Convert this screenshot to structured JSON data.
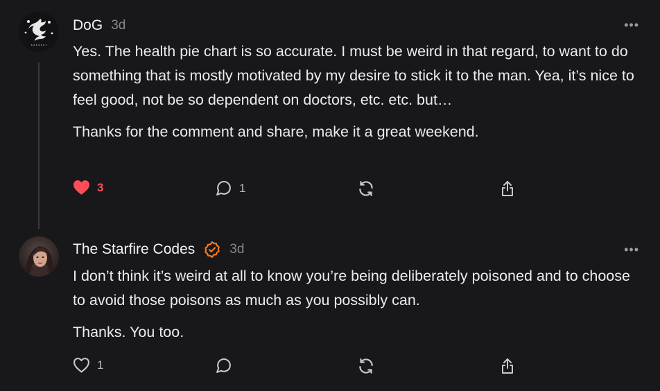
{
  "comments": [
    {
      "author": "DoG",
      "time": "3d",
      "verified": false,
      "paragraphs": [
        "Yes. The health pie chart is so accurate. I must be weird in that regard, to want to do something that is mostly motivated by my desire to stick it to the man. Yea, it’s nice to feel good, not be so dependent on doctors, etc. etc. but…",
        "Thanks for the comment and share, make it a great weekend."
      ],
      "likes": "3",
      "liked": true,
      "replies": "1",
      "more_label": "•••"
    },
    {
      "author": "The Starfire Codes",
      "time": "3d",
      "verified": true,
      "paragraphs": [
        "I don’t think it’s weird at all to know you’re being deliberately poisoned and to choose to avoid those poisons as much as you possibly can.",
        "Thanks. You too."
      ],
      "likes": "1",
      "liked": false,
      "replies": "",
      "more_label": "•••"
    }
  ],
  "colors": {
    "background": "#18181a",
    "text": "#ececee",
    "muted": "#86868c",
    "like_active": "#ff4d58",
    "verified_badge": "#ff7a1a"
  },
  "icons": {
    "like": "heart-icon",
    "reply": "speech-bubble-icon",
    "restack": "restack-arrows-icon",
    "share": "share-upload-icon",
    "more": "ellipsis-icon",
    "verified": "verified-check-badge-icon"
  }
}
